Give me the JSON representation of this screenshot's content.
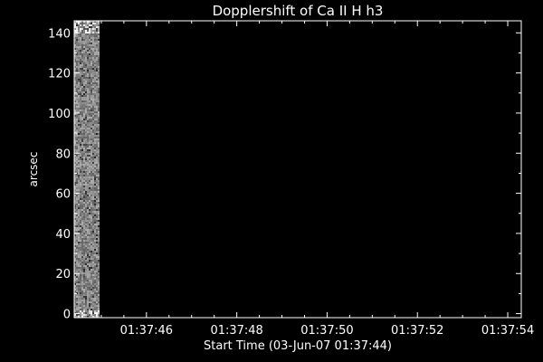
{
  "chart_data": {
    "type": "heatmap",
    "title": "Dopplershift of Ca II H h3",
    "xlabel": "Start Time (03-Jun-07 01:37:44)",
    "ylabel": "arcsec",
    "x_start": "01:37:44",
    "xlim_seconds_from_start": [
      0.4,
      10.3
    ],
    "ylim": [
      -2,
      146
    ],
    "x_ticks": [
      {
        "label": "01:37:46",
        "seconds": 2
      },
      {
        "label": "01:37:48",
        "seconds": 4
      },
      {
        "label": "01:37:50",
        "seconds": 6
      },
      {
        "label": "01:37:52",
        "seconds": 8
      },
      {
        "label": "01:37:54",
        "seconds": 10
      }
    ],
    "y_ticks": [
      0,
      20,
      40,
      60,
      80,
      100,
      120,
      140
    ],
    "data_coverage": {
      "x_range_seconds": [
        0.4,
        0.95
      ],
      "y_range": [
        -2,
        146
      ],
      "colormap": "grayscale"
    },
    "background_color": "#000000",
    "axis_color": "#ffffff"
  }
}
